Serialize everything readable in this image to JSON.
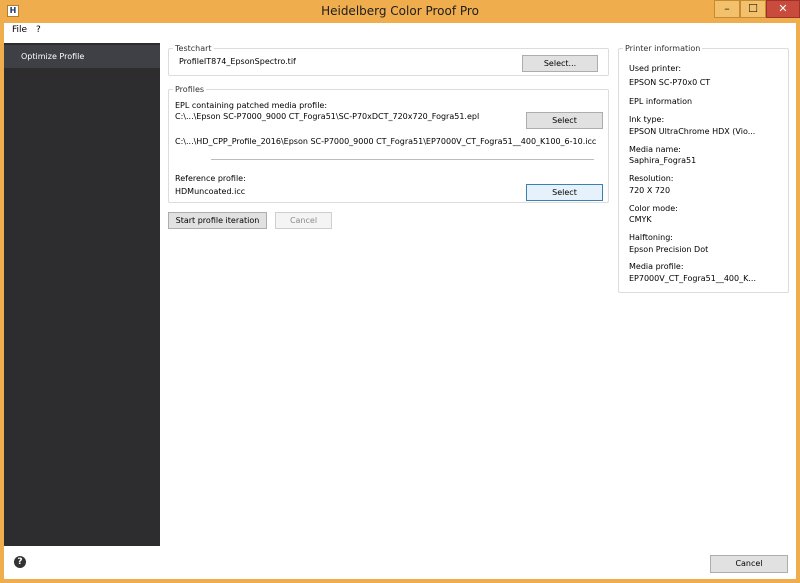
{
  "window": {
    "title": "Heidelberg Color Proof Pro",
    "app_icon_letter": "H",
    "minimize": "–",
    "maximize": "☐",
    "close": "✕"
  },
  "menu": {
    "items": [
      "File",
      "?"
    ]
  },
  "sidebar": {
    "items": [
      {
        "label": "Optimize Profile"
      }
    ]
  },
  "help": "?",
  "testchart": {
    "legend": "Testchart",
    "file": "ProfileIT874_EpsonSpectro.tif",
    "select_label": "Select..."
  },
  "profiles": {
    "legend": "Profiles",
    "epl_label": "EPL containing patched media profile:",
    "epl_path": "C:\\...\\Epson SC-P7000_9000 CT_Fogra51\\SC-P70xDCT_720x720_Fogra51.epl",
    "icc_path": "C:\\...\\HD_CPP_Profile_2016\\Epson SC-P7000_9000 CT_Fogra51\\EP7000V_CT_Fogra51__400_K100_6-10.icc",
    "select_epl_label": "Select",
    "reference_label": "Reference profile:",
    "reference_value": "HDMuncoated.icc",
    "select_reference_label": "Select"
  },
  "actions": {
    "start_label": "Start profile iteration",
    "cancel_label": "Cancel"
  },
  "printer_info": {
    "legend": "Printer information",
    "used_printer_label": "Used printer:",
    "used_printer_value": "EPSON SC-P70x0 CT",
    "epl_info_label": "EPL information",
    "ink_type_label": "Ink type:",
    "ink_type_value": "EPSON UltraChrome HDX (Vio...",
    "media_name_label": "Media name:",
    "media_name_value": "Saphira_Fogra51",
    "resolution_label": "Resolution:",
    "resolution_value": "720 X 720",
    "color_mode_label": "Color mode:",
    "color_mode_value": "CMYK",
    "halftoning_label": "Halftoning:",
    "halftoning_value": "Epson Precision Dot",
    "media_profile_label": "Media profile:",
    "media_profile_value": "EP7000V_CT_Fogra51__400_K..."
  },
  "footer": {
    "cancel_label": "Cancel"
  },
  "colors": {
    "title_bar": "#f0ad4e",
    "sidebar_bg": "#2d2d30",
    "sidebar_selected": "#3f3f46",
    "close_button": "#c94b3d"
  }
}
